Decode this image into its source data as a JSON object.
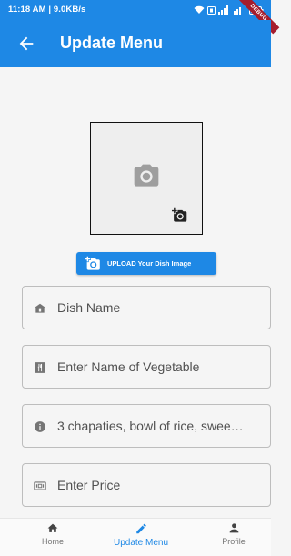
{
  "status_bar": {
    "time_speed": "11:18 AM | 9.0KB/s",
    "debug_banner": "DEBUG"
  },
  "app_bar": {
    "title": "Update Menu",
    "back_icon": "arrow-back-icon"
  },
  "image_picker": {
    "placeholder_icon": "camera-icon",
    "add_icon": "add-photo-icon"
  },
  "upload_button": {
    "label": "UPLOAD Your Dish Image",
    "icon": "add-photo-icon"
  },
  "fields": {
    "dish_name": {
      "icon": "store-icon",
      "text": "Dish Name"
    },
    "vegetable": {
      "icon": "restaurant-menu-icon",
      "text": "Enter Name of Vegetable"
    },
    "description": {
      "icon": "info-icon",
      "text": "3 chapaties, bowl of rice, swee…"
    },
    "price": {
      "icon": "money-icon",
      "text": "Enter Price"
    }
  },
  "bottom_nav": {
    "items": [
      {
        "label": "Home",
        "icon": "home-icon",
        "active": false
      },
      {
        "label": "Update Menu",
        "icon": "edit-icon",
        "active": true
      },
      {
        "label": "Profile",
        "icon": "person-icon",
        "active": false
      }
    ]
  },
  "colors": {
    "primary": "#1e88e5",
    "background": "#f5f5f5",
    "debug": "#a51d2d"
  }
}
